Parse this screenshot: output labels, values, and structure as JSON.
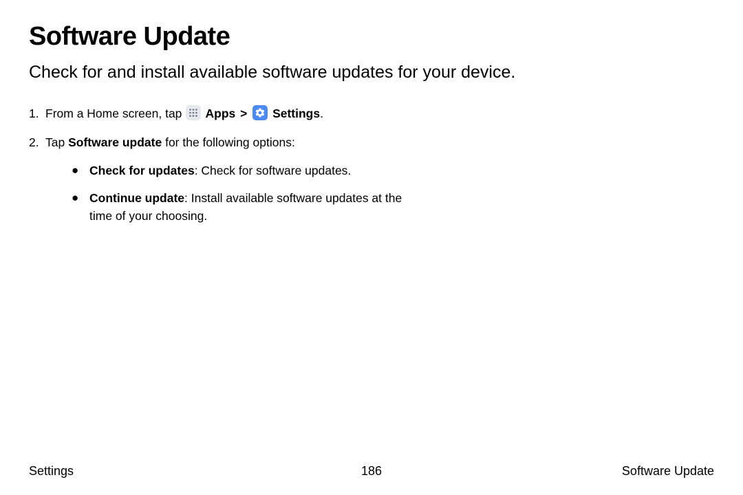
{
  "title": "Software Update",
  "subtitle": "Check for and install available software updates for your device.",
  "steps": {
    "step1": {
      "num": "1.",
      "pre": "From a Home screen, tap ",
      "apps_label": " Apps",
      "chevron": " > ",
      "settings_label": " Settings",
      "post": "."
    },
    "step2": {
      "num": "2.",
      "pre": "Tap ",
      "bold": "Software update",
      "post": " for the following options:"
    }
  },
  "bullets": {
    "b1": {
      "bold": "Check for updates",
      "rest": ": Check for software updates."
    },
    "b2": {
      "bold": "Continue update",
      "rest": ": Install available software updates at the time of your choosing."
    }
  },
  "footer": {
    "left": "Settings",
    "center": "186",
    "right": "Software Update"
  }
}
